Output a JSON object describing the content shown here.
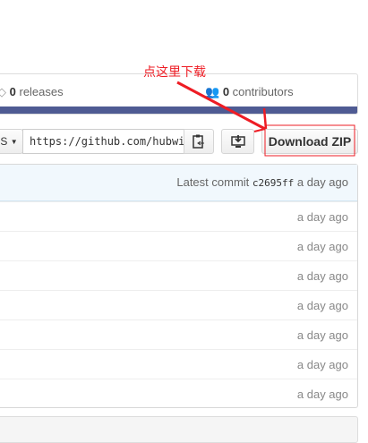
{
  "annotation": {
    "text": "点这里下载",
    "color": "#ee1c24"
  },
  "stats": {
    "releases_count": "0",
    "releases_label": "releases",
    "contributors_count": "0",
    "contributors_label": "contributors",
    "bar_color": "#4f5b93"
  },
  "clone": {
    "branch_fragment": "S",
    "url": "https://github.com/hubwi"
  },
  "buttons": {
    "download_zip": "Download ZIP"
  },
  "commits": {
    "latest_label": "Latest commit",
    "sha": "c2695ff",
    "latest_time": "a day ago",
    "rows": [
      "a day ago",
      "a day ago",
      "a day ago",
      "a day ago",
      "a day ago",
      "a day ago",
      "a day ago"
    ]
  }
}
